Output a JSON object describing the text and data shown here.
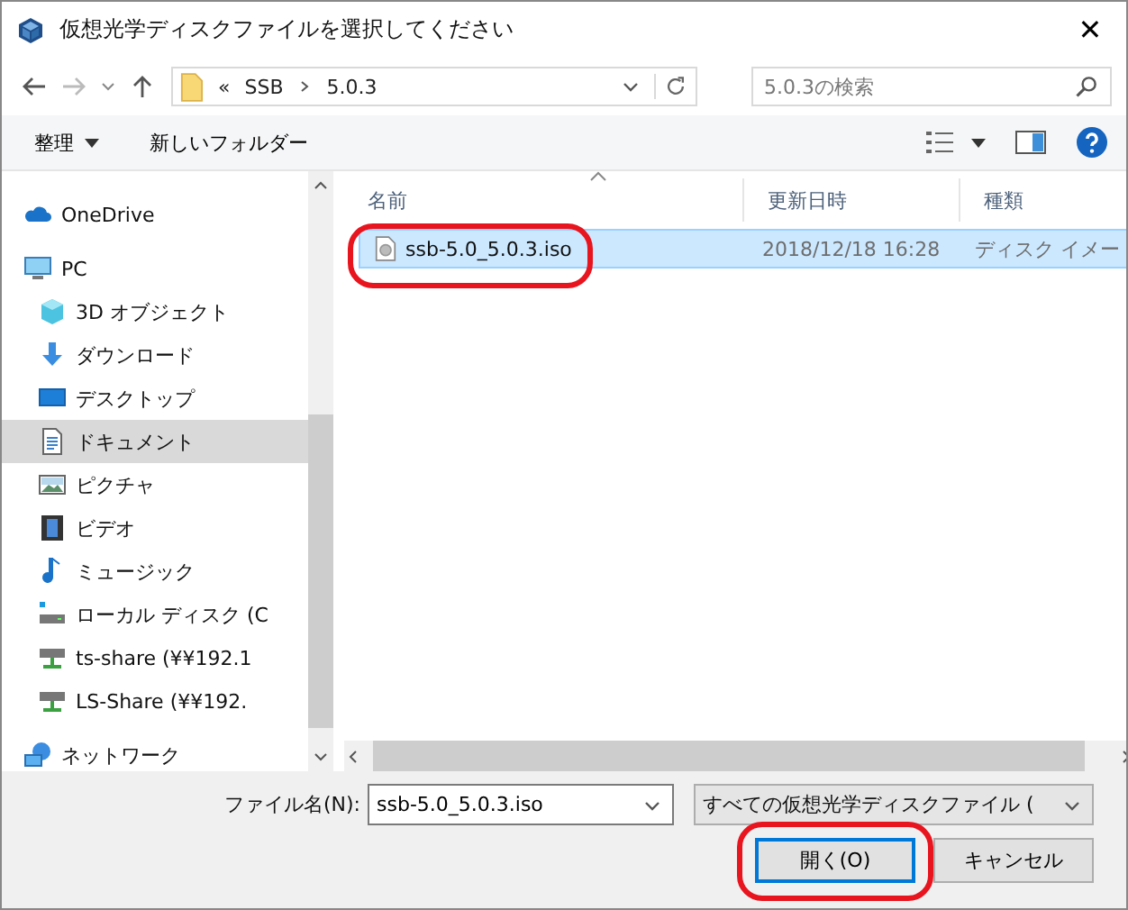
{
  "window": {
    "title": "仮想光学ディスクファイルを選択してください",
    "close": "✕"
  },
  "address": {
    "overflow": "«",
    "crumbs": [
      "SSB",
      "5.0.3"
    ]
  },
  "search": {
    "placeholder": "5.0.3の検索"
  },
  "toolbar": {
    "organize": "整理",
    "new_folder": "新しいフォルダー"
  },
  "sidebar": {
    "items": [
      {
        "kind": "cloud",
        "label": "OneDrive",
        "selected": false
      },
      {
        "kind": "pc",
        "label": "PC",
        "selected": false,
        "children": [
          {
            "kind": "cube",
            "label": "3D オブジェクト",
            "selected": false
          },
          {
            "kind": "download",
            "label": "ダウンロード",
            "selected": false
          },
          {
            "kind": "desktop",
            "label": "デスクトップ",
            "selected": false
          },
          {
            "kind": "document",
            "label": "ドキュメント",
            "selected": true
          },
          {
            "kind": "pictures",
            "label": "ピクチャ",
            "selected": false
          },
          {
            "kind": "video",
            "label": "ビデオ",
            "selected": false
          },
          {
            "kind": "music",
            "label": "ミュージック",
            "selected": false
          },
          {
            "kind": "localdisk",
            "label": "ローカル ディスク (C",
            "selected": false
          },
          {
            "kind": "netdrive",
            "label": "ts-share (¥¥192.1",
            "selected": false
          },
          {
            "kind": "netdrive",
            "label": "LS-Share (¥¥192.",
            "selected": false
          }
        ]
      },
      {
        "kind": "network",
        "label": "ネットワーク",
        "selected": false
      }
    ]
  },
  "table": {
    "columns": [
      "名前",
      "更新日時",
      "種類"
    ],
    "rows": [
      {
        "name": "ssb-5.0_5.0.3.iso",
        "modified": "2018/12/18 16:28",
        "type": "ディスク イメー",
        "selected": true,
        "circled": true
      }
    ]
  },
  "filename": {
    "label": "ファイル名(N):",
    "value": "ssb-5.0_5.0.3.iso"
  },
  "filter": {
    "value": "すべての仮想光学ディスクファイル ("
  },
  "buttons": [
    {
      "label": "開く(O)",
      "default": true,
      "circled": true
    },
    {
      "label": "キャンセル",
      "default": false,
      "circled": false
    }
  ]
}
